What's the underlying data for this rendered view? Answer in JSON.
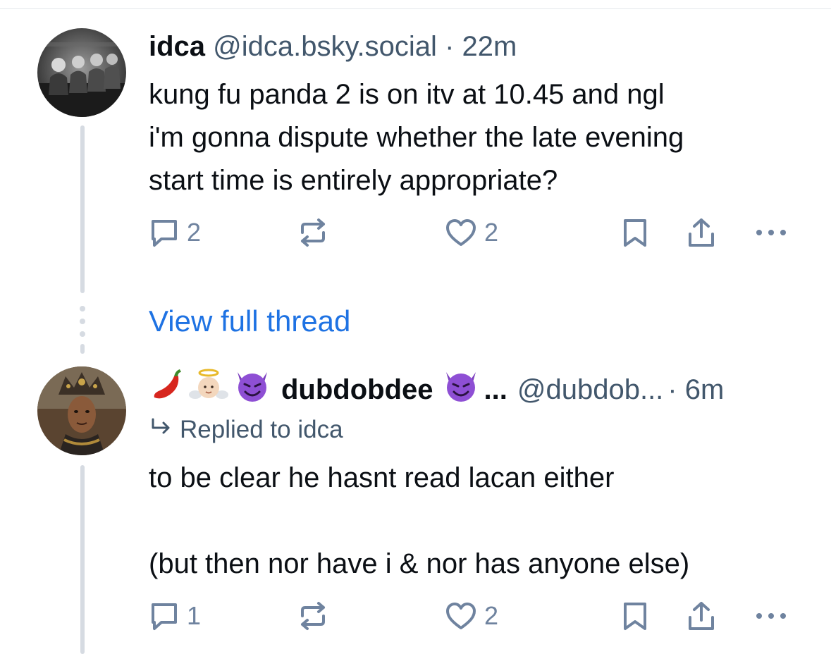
{
  "post1": {
    "display_name": "idca",
    "handle": "@idca.bsky.social",
    "time": "· 22m",
    "text_lines": [
      "kung fu panda 2 is on itv at 10.45 and ngl",
      "i'm gonna dispute whether the late evening",
      "start time is entirely appropriate?"
    ],
    "reply_count": "2",
    "repost_count": "",
    "like_count": "2"
  },
  "view_thread_label": "View full thread",
  "post2": {
    "display_name": "dubdobdee",
    "name_suffix": "...",
    "handle": "@dubdob...",
    "time": "· 6m",
    "replied_to": "Replied to idca",
    "text_lines": [
      "to be clear he hasnt read lacan either",
      "",
      "(but then nor have i & nor has anyone else)"
    ],
    "reply_count": "1",
    "repost_count": "",
    "like_count": "2"
  },
  "colors": {
    "text": "#0b0f14",
    "muted": "#42576c",
    "icon": "#6f839f",
    "link": "#1e72e3",
    "thread_line": "#d6dbe2"
  },
  "icons": [
    "reply-icon",
    "repost-icon",
    "like-icon",
    "bookmark-icon",
    "share-icon",
    "more-icon",
    "reply-arrow-icon",
    "chili-emoji",
    "angel-baby-emoji",
    "devil-emoji"
  ]
}
